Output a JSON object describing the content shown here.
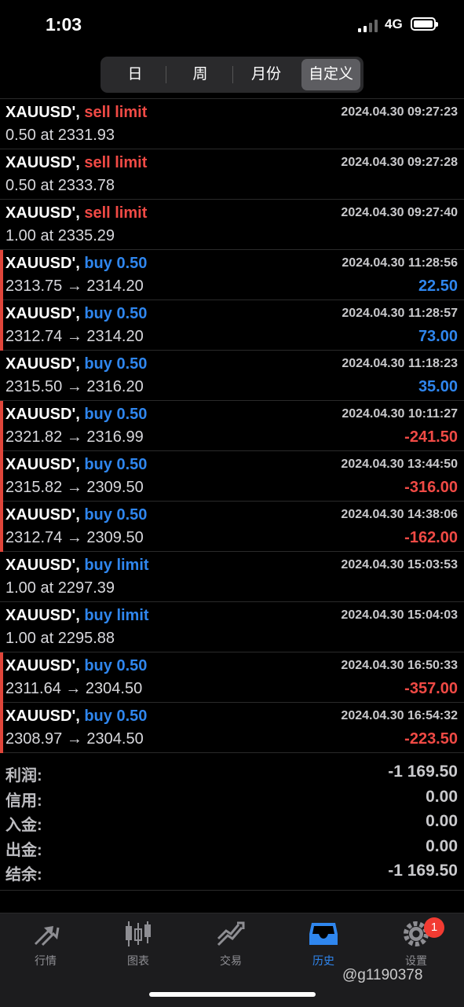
{
  "status": {
    "time": "1:03",
    "network": "4G"
  },
  "tabs": [
    "日",
    "周",
    "月份",
    "自定义"
  ],
  "active_tab": 3,
  "orders": [
    {
      "symbol": "XAUUSD',",
      "type": "sell limit",
      "type_color": "sell",
      "date": "2024.04.30 09:27:23",
      "detail": "0.50 at 2331.93",
      "profit": "",
      "profit_sign": "",
      "marker": false
    },
    {
      "symbol": "XAUUSD',",
      "type": "sell limit",
      "type_color": "sell",
      "date": "2024.04.30 09:27:28",
      "detail": "0.50 at 2333.78",
      "profit": "",
      "profit_sign": "",
      "marker": false
    },
    {
      "symbol": "XAUUSD',",
      "type": "sell limit",
      "type_color": "sell",
      "date": "2024.04.30 09:27:40",
      "detail": "1.00 at 2335.29",
      "profit": "",
      "profit_sign": "",
      "marker": false
    },
    {
      "symbol": "XAUUSD',",
      "type": "buy 0.50",
      "type_color": "buy",
      "date": "2024.04.30 11:28:56",
      "detail": "2313.75 → 2314.20",
      "profit": "22.50",
      "profit_sign": "pos",
      "marker": true
    },
    {
      "symbol": "XAUUSD',",
      "type": "buy 0.50",
      "type_color": "buy",
      "date": "2024.04.30 11:28:57",
      "detail": "2312.74 → 2314.20",
      "profit": "73.00",
      "profit_sign": "pos",
      "marker": true
    },
    {
      "symbol": "XAUUSD',",
      "type": "buy 0.50",
      "type_color": "buy",
      "date": "2024.04.30 11:18:23",
      "detail": "2315.50 → 2316.20",
      "profit": "35.00",
      "profit_sign": "pos",
      "marker": false
    },
    {
      "symbol": "XAUUSD',",
      "type": "buy 0.50",
      "type_color": "buy",
      "date": "2024.04.30 10:11:27",
      "detail": "2321.82 → 2316.99",
      "profit": "-241.50",
      "profit_sign": "neg",
      "marker": true
    },
    {
      "symbol": "XAUUSD',",
      "type": "buy 0.50",
      "type_color": "buy",
      "date": "2024.04.30 13:44:50",
      "detail": "2315.82 → 2309.50",
      "profit": "-316.00",
      "profit_sign": "neg",
      "marker": true
    },
    {
      "symbol": "XAUUSD',",
      "type": "buy 0.50",
      "type_color": "buy",
      "date": "2024.04.30 14:38:06",
      "detail": "2312.74 → 2309.50",
      "profit": "-162.00",
      "profit_sign": "neg",
      "marker": true
    },
    {
      "symbol": "XAUUSD',",
      "type": "buy limit",
      "type_color": "buy",
      "date": "2024.04.30 15:03:53",
      "detail": "1.00 at 2297.39",
      "profit": "",
      "profit_sign": "",
      "marker": false
    },
    {
      "symbol": "XAUUSD',",
      "type": "buy limit",
      "type_color": "buy",
      "date": "2024.04.30 15:04:03",
      "detail": "1.00 at 2295.88",
      "profit": "",
      "profit_sign": "",
      "marker": false
    },
    {
      "symbol": "XAUUSD',",
      "type": "buy 0.50",
      "type_color": "buy",
      "date": "2024.04.30 16:50:33",
      "detail": "2311.64 → 2304.50",
      "profit": "-357.00",
      "profit_sign": "neg",
      "marker": true
    },
    {
      "symbol": "XAUUSD',",
      "type": "buy 0.50",
      "type_color": "buy",
      "date": "2024.04.30 16:54:32",
      "detail": "2308.97 → 2304.50",
      "profit": "-223.50",
      "profit_sign": "neg",
      "marker": true
    }
  ],
  "summary": [
    {
      "label": "利润:",
      "value": "-1 169.50"
    },
    {
      "label": "信用:",
      "value": "0.00"
    },
    {
      "label": "入金:",
      "value": "0.00"
    },
    {
      "label": "出金:",
      "value": "0.00"
    },
    {
      "label": "结余:",
      "value": "-1 169.50"
    }
  ],
  "tabbar": [
    {
      "label": "行情",
      "icon": "quotes-arrows-icon"
    },
    {
      "label": "图表",
      "icon": "candlestick-chart-icon"
    },
    {
      "label": "交易",
      "icon": "trade-trend-icon"
    },
    {
      "label": "历史",
      "icon": "history-inbox-icon"
    },
    {
      "label": "设置",
      "icon": "settings-gear-icon",
      "badge": "1"
    }
  ],
  "active_tabbar": 3,
  "watermark": "@g1190378",
  "colors": {
    "sell": "#f04a45",
    "buy": "#2f86ee",
    "marker": "#e0453a",
    "active_tab": "#2f86ee"
  }
}
